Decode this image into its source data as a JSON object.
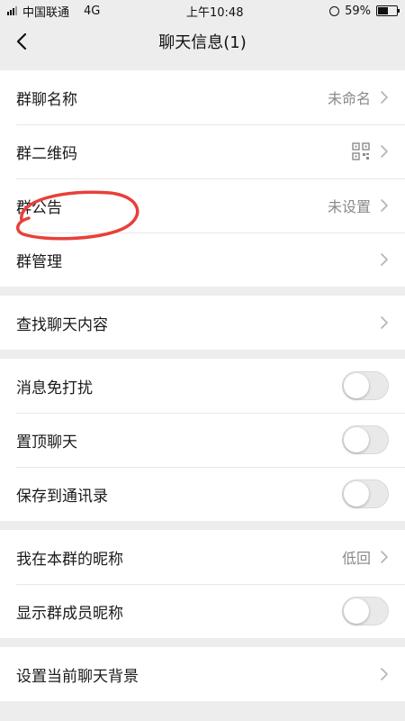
{
  "status": {
    "carrier": "中国联通",
    "network": "4G",
    "time": "上午10:48",
    "battery": "59%",
    "battery_fraction": 0.59
  },
  "nav": {
    "title": "聊天信息(1)"
  },
  "group1": {
    "name_label": "群聊名称",
    "name_value": "未命名",
    "qrcode_label": "群二维码",
    "notice_label": "群公告",
    "notice_value": "未设置",
    "manage_label": "群管理"
  },
  "group2": {
    "search_label": "查找聊天内容"
  },
  "group3": {
    "mute_label": "消息免打扰",
    "sticky_label": "置顶聊天",
    "save_contacts_label": "保存到通讯录"
  },
  "group4": {
    "nickname_label": "我在本群的昵称",
    "nickname_value": "低回",
    "show_nickname_label": "显示群成员昵称"
  },
  "group5": {
    "background_label": "设置当前聊天背景"
  },
  "icons": {
    "back": "chevron-left-icon",
    "chevron": "chevron-right-icon",
    "qr": "qr-code-icon"
  },
  "colors": {
    "background": "#ededed",
    "annotation": "#e8403a"
  }
}
